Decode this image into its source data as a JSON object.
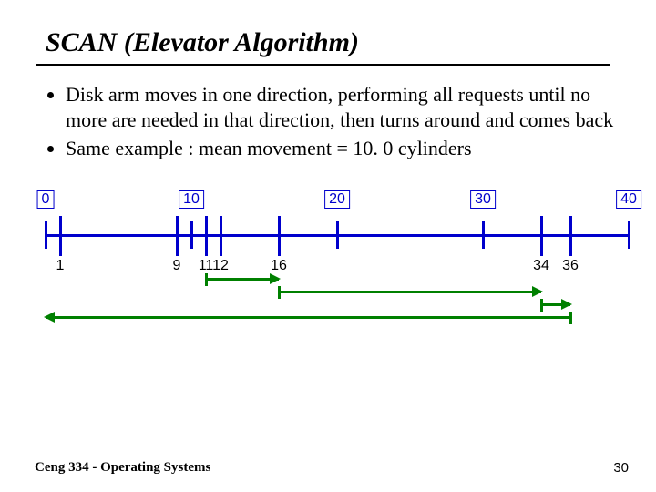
{
  "title": "SCAN (Elevator Algorithm)",
  "bullets": [
    "Disk arm moves in one direction, performing all requests until no more are needed in that direction, then turns around and comes back",
    "Same example : mean movement = 10. 0 cylinders"
  ],
  "chart_data": {
    "type": "diagram",
    "axis_range": [
      0,
      40
    ],
    "major_ticks": [
      0,
      10,
      20,
      30,
      40
    ],
    "minor_ticks": [
      1,
      9,
      11,
      12,
      16,
      34,
      36
    ],
    "arrows": [
      {
        "from": 11,
        "to": 16,
        "dir": "right",
        "row": 0
      },
      {
        "from": 16,
        "to": 34,
        "dir": "right",
        "row": 1
      },
      {
        "from": 34,
        "to": 36,
        "dir": "right",
        "row": 2
      },
      {
        "from": 36,
        "to": 0,
        "dir": "left",
        "row": 3
      }
    ]
  },
  "footer": "Ceng 334 - Operating Systems",
  "page": "30"
}
